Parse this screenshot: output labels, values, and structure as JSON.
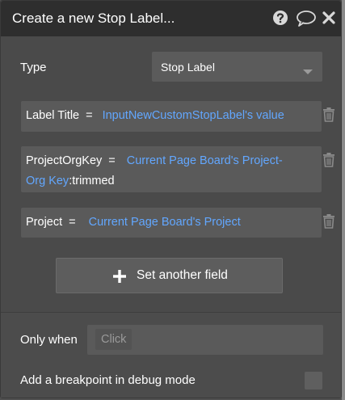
{
  "dialog": {
    "title": "Create a new Stop Label...",
    "icons": [
      "question-circle-icon",
      "comment-bubble-icon",
      "close-x-icon"
    ]
  },
  "type_field": {
    "label": "Type",
    "selected_value": "Stop Label"
  },
  "fields": [
    {
      "key": "Label Title",
      "eq": "=",
      "value": "InputNewCustomStopLabel's value",
      "suffix": ""
    },
    {
      "key": "ProjectOrgKey",
      "eq": "=",
      "value_line1": "Current Page Board's Project-",
      "value_line2": "Org Key",
      "suffix": ":trimmed"
    },
    {
      "key": "Project",
      "eq": "=",
      "value": "Current Page Board's Project",
      "suffix": ""
    }
  ],
  "set_field_button": {
    "label": "Set another field"
  },
  "only_when": {
    "label": "Only when",
    "placeholder": "Click"
  },
  "debug": {
    "label": "Add a breakpoint in debug mode",
    "checked": false
  },
  "colors": {
    "dynamic_value": "#62a7ff",
    "panel_bg": "#4a4a4a",
    "titlebar_bg": "#2e2e2e"
  }
}
